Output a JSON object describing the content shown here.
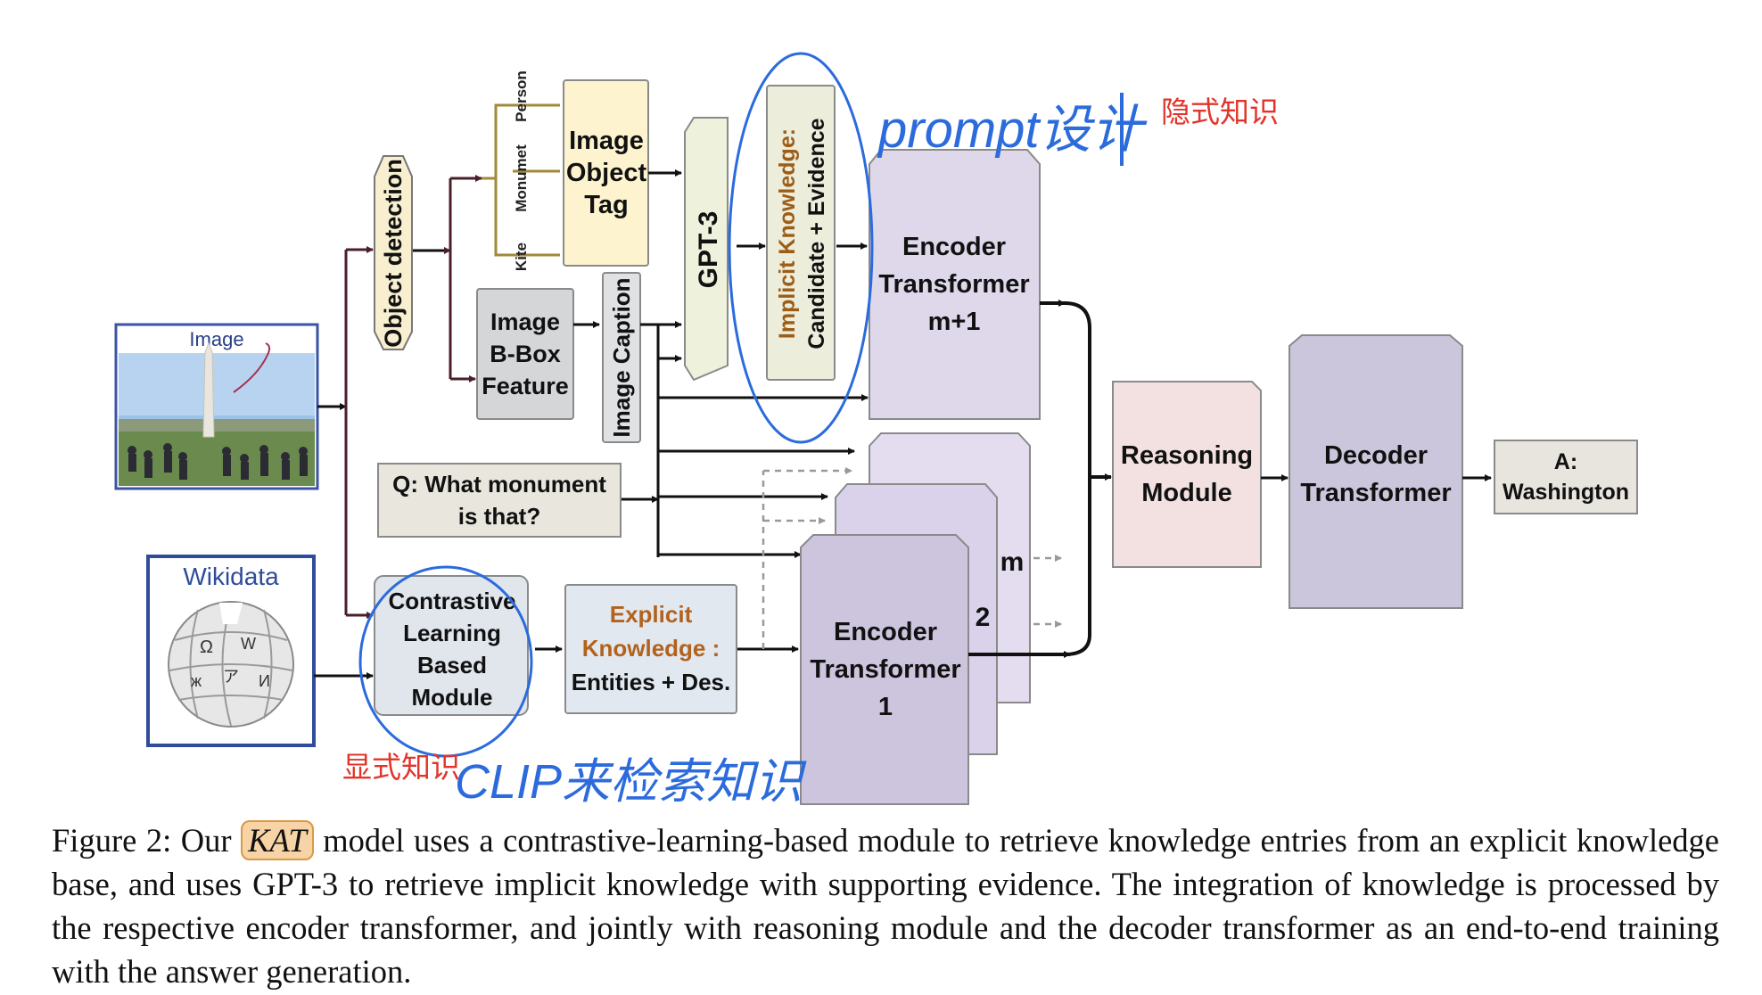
{
  "inputs": {
    "image_label": "Image",
    "wikidata_label": "Wikidata"
  },
  "object_detection": "Object detection",
  "object_tags": {
    "person": "Person",
    "monument": "Monumet",
    "kite": "Kite"
  },
  "image_object_tag": [
    "Image",
    "Object",
    "Tag"
  ],
  "image_bbox_feature": [
    "Image",
    "B-Box",
    "Feature"
  ],
  "image_caption": "Image Caption",
  "gpt3": "GPT-3",
  "implicit_knowledge": {
    "title": "Implicit Knowledge:",
    "detail": "Candidate + Evidence"
  },
  "encoder_top": [
    "Encoder",
    "Transformer",
    "m+1"
  ],
  "question": [
    "Q: What monument",
    "is that?"
  ],
  "contrastive_module": [
    "Contrastive",
    "Learning",
    "Based",
    "Module"
  ],
  "explicit_knowledge": [
    "Explicit",
    "Knowledge :",
    "Entities + Des."
  ],
  "encoder_bottom": [
    "Encoder",
    "Transformer",
    "1"
  ],
  "stack_labels": {
    "m": "m",
    "two": "2"
  },
  "reasoning_module": [
    "Reasoning",
    "Module"
  ],
  "decoder_transformer": [
    "Decoder",
    "Transformer"
  ],
  "answer": [
    "A:",
    "Washington"
  ],
  "annotations": {
    "prompt_handwritten": "prompt设计",
    "implicit_cn": "隐式知识",
    "explicit_cn": "显式知识",
    "clip_handwritten": "CLIP来检索知识"
  },
  "caption": {
    "prefix": "Figure 2: Our",
    "model_name": "KAT",
    "body": "model uses a contrastive-learning-based module to retrieve knowledge entries from an explicit knowledge base, and uses GPT-3 to retrieve implicit knowledge with supporting evidence. The integration of knowledge is processed by the respective encoder transformer, and jointly with reasoning module and the decoder transformer as an end-to-end training with the answer generation."
  },
  "colors": {
    "object_detection_fill": "#f7efcf",
    "object_tag_fill": "#fdf3cf",
    "bbox_fill": "#d4d6d8",
    "caption_fill": "#dfe1e3",
    "gpt_fill": "#eef1db",
    "implicit_fill": "#ecedda",
    "implicit_text": "#9c5d18",
    "encoder_fill": "#ded8ea",
    "encoder_bottom_fill": "#cdc5de",
    "question_fill": "#e8e6dd",
    "contrastive_fill": "#e1e6ed",
    "explicit_fill": "#e2e8f0",
    "reasoning_fill": "#f3e1e1",
    "decoder_fill": "#cbc6dc",
    "answer_fill": "#e7e5dd",
    "handwriting_blue": "#2b6bdc",
    "annotation_red": "#e2342b",
    "image_frame": "#3b54a3",
    "wiki_frame": "#2e4c9a"
  }
}
